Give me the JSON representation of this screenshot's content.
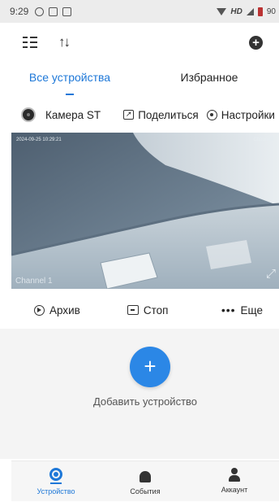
{
  "status_bar": {
    "time": "9:29",
    "hd_label": "HD",
    "battery": "90"
  },
  "tabs": [
    {
      "label": "Все устройства",
      "active": true
    },
    {
      "label": "Избранное",
      "active": false
    }
  ],
  "camera_bar": {
    "device_name": "Камера ST",
    "share_label": "Поделиться",
    "settings_label": "Настройки"
  },
  "video": {
    "osd_timestamp": "2024-09-25 10:29:21",
    "osd_channel": "Channel1",
    "channel_label": "Channel 1"
  },
  "actions": {
    "archive_label": "Архив",
    "stop_label": "Стоп",
    "more_label": "Еще",
    "more_glyph": "•••"
  },
  "empty_state": {
    "add_glyph": "+",
    "add_label": "Добавить устройство"
  },
  "bottom_nav": [
    {
      "label": "Устройство",
      "active": true
    },
    {
      "label": "События",
      "active": false
    },
    {
      "label": "Аккаунт",
      "active": false
    }
  ],
  "colors": {
    "accent": "#1e78d8",
    "add_button": "#2b87e6"
  }
}
